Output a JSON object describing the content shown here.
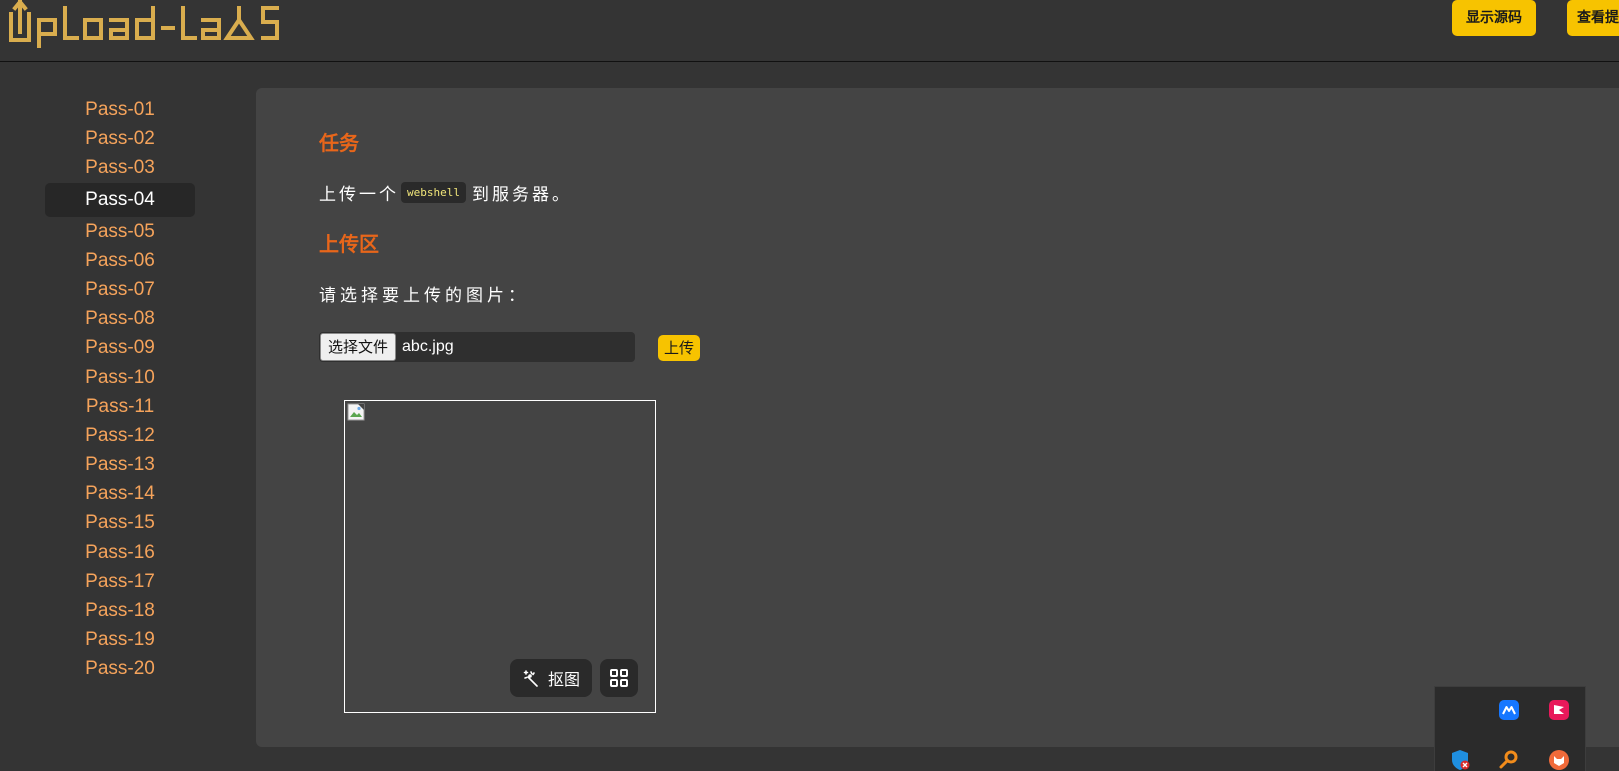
{
  "header": {
    "logo_text": "upload-labs",
    "show_source_label": "显示源码",
    "view_hint_label": "查看提示"
  },
  "sidebar": {
    "items": [
      {
        "label": "Pass-01"
      },
      {
        "label": "Pass-02"
      },
      {
        "label": "Pass-03"
      },
      {
        "label": "Pass-04",
        "active": true
      },
      {
        "label": "Pass-05"
      },
      {
        "label": "Pass-06"
      },
      {
        "label": "Pass-07"
      },
      {
        "label": "Pass-08"
      },
      {
        "label": "Pass-09"
      },
      {
        "label": "Pass-10"
      },
      {
        "label": "Pass-11"
      },
      {
        "label": "Pass-12"
      },
      {
        "label": "Pass-13"
      },
      {
        "label": "Pass-14"
      },
      {
        "label": "Pass-15"
      },
      {
        "label": "Pass-16"
      },
      {
        "label": "Pass-17"
      },
      {
        "label": "Pass-18"
      },
      {
        "label": "Pass-19"
      },
      {
        "label": "Pass-20"
      }
    ]
  },
  "main": {
    "task_title": "任务",
    "task_prefix": "上传一个",
    "task_code": "webshell",
    "task_suffix": "到服务器。",
    "upload_title": "上传区",
    "prompt": "请选择要上传的图片：",
    "choose_file_label": "选择文件",
    "file_name": "abc.jpg",
    "submit_label": "上传",
    "cutout_label": "抠图"
  },
  "colors": {
    "accent_yellow": "#f7c300",
    "title_orange": "#e8661a",
    "nav_orange": "#f5a35b",
    "background": "#343434",
    "panel": "#444444"
  },
  "icons": {
    "logo": "upload-labs-logo",
    "broken_image": "broken-image-icon",
    "magic_wand": "magic-wand-icon",
    "grid": "grid-icon"
  }
}
